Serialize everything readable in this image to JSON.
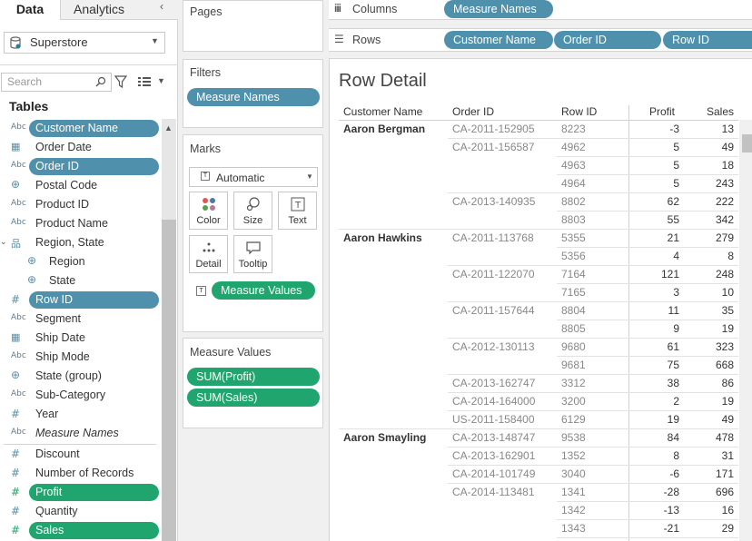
{
  "left_pane": {
    "tab_data": "Data",
    "tab_analytics": "Analytics",
    "collapse": "‹",
    "datasource": "Superstore",
    "search_placeholder": "Search",
    "tables_title": "Tables",
    "fields": [
      {
        "icon": "Abc",
        "label": "Customer Name",
        "style": "blue"
      },
      {
        "icon": "calendar-icon",
        "label": "Order Date",
        "style": ""
      },
      {
        "icon": "Abc",
        "label": "Order ID",
        "style": "blue"
      },
      {
        "icon": "globe-icon",
        "label": "Postal Code",
        "style": ""
      },
      {
        "icon": "Abc",
        "label": "Product ID",
        "style": ""
      },
      {
        "icon": "Abc",
        "label": "Product Name",
        "style": ""
      },
      {
        "icon": "hierarchy-icon",
        "label": "Region, State",
        "style": "hier"
      },
      {
        "icon": "globe-icon",
        "label": "Region",
        "style": "indent"
      },
      {
        "icon": "globe-icon",
        "label": "State",
        "style": "indent"
      },
      {
        "icon": "#",
        "label": "Row ID",
        "style": "blue"
      },
      {
        "icon": "Abc",
        "label": "Segment",
        "style": ""
      },
      {
        "icon": "calendar-icon",
        "label": "Ship Date",
        "style": ""
      },
      {
        "icon": "Abc",
        "label": "Ship Mode",
        "style": ""
      },
      {
        "icon": "globe-icon",
        "label": "State (group)",
        "style": ""
      },
      {
        "icon": "Abc",
        "label": "Sub-Category",
        "style": ""
      },
      {
        "icon": "#",
        "label": "Year",
        "style": ""
      },
      {
        "icon": "Abc",
        "label": "Measure Names",
        "style": "italic"
      },
      {
        "icon": "#",
        "label": "Discount",
        "style": ""
      },
      {
        "icon": "#",
        "label": "Number of Records",
        "style": ""
      },
      {
        "icon": "#",
        "label": "Profit",
        "style": "green"
      },
      {
        "icon": "#",
        "label": "Quantity",
        "style": ""
      },
      {
        "icon": "#",
        "label": "Sales",
        "style": "green"
      }
    ]
  },
  "shelves": {
    "pages": "Pages",
    "filters": "Filters",
    "filter_pill": "Measure Names",
    "marks": "Marks",
    "mark_type": "Automatic",
    "mark_buttons": [
      "Color",
      "Size",
      "Text",
      "Detail",
      "Tooltip"
    ],
    "marks_pill": "Measure Values",
    "measure_values_title": "Measure Values",
    "measure_values_pills": [
      "SUM(Profit)",
      "SUM(Sales)"
    ],
    "columns_label": "Columns",
    "columns_pill": "Measure Names",
    "rows_label": "Rows",
    "rows_pills": [
      "Customer Name",
      "Order ID",
      "Row ID"
    ]
  },
  "view": {
    "title": "Row Detail",
    "headers": [
      "Customer Name",
      "Order ID",
      "Row ID",
      "Profit",
      "Sales"
    ],
    "rows": [
      {
        "customer": "Aaron Bergman",
        "order": "CA-2011-152905",
        "row_id": "8223",
        "profit": "-3",
        "sales": "13"
      },
      {
        "customer": "",
        "order": "CA-2011-156587",
        "row_id": "4962",
        "profit": "5",
        "sales": "49"
      },
      {
        "customer": "",
        "order": "",
        "row_id": "4963",
        "profit": "5",
        "sales": "18"
      },
      {
        "customer": "",
        "order": "",
        "row_id": "4964",
        "profit": "5",
        "sales": "243"
      },
      {
        "customer": "",
        "order": "CA-2013-140935",
        "row_id": "8802",
        "profit": "62",
        "sales": "222"
      },
      {
        "customer": "",
        "order": "",
        "row_id": "8803",
        "profit": "55",
        "sales": "342"
      },
      {
        "customer": "Aaron Hawkins",
        "order": "CA-2011-113768",
        "row_id": "5355",
        "profit": "21",
        "sales": "279"
      },
      {
        "customer": "",
        "order": "",
        "row_id": "5356",
        "profit": "4",
        "sales": "8"
      },
      {
        "customer": "",
        "order": "CA-2011-122070",
        "row_id": "7164",
        "profit": "121",
        "sales": "248"
      },
      {
        "customer": "",
        "order": "",
        "row_id": "7165",
        "profit": "3",
        "sales": "10"
      },
      {
        "customer": "",
        "order": "CA-2011-157644",
        "row_id": "8804",
        "profit": "11",
        "sales": "35"
      },
      {
        "customer": "",
        "order": "",
        "row_id": "8805",
        "profit": "9",
        "sales": "19"
      },
      {
        "customer": "",
        "order": "CA-2012-130113",
        "row_id": "9680",
        "profit": "61",
        "sales": "323"
      },
      {
        "customer": "",
        "order": "",
        "row_id": "9681",
        "profit": "75",
        "sales": "668"
      },
      {
        "customer": "",
        "order": "CA-2013-162747",
        "row_id": "3312",
        "profit": "38",
        "sales": "86"
      },
      {
        "customer": "",
        "order": "CA-2014-164000",
        "row_id": "3200",
        "profit": "2",
        "sales": "19"
      },
      {
        "customer": "",
        "order": "US-2011-158400",
        "row_id": "6129",
        "profit": "19",
        "sales": "49"
      },
      {
        "customer": "Aaron Smayling",
        "order": "CA-2013-148747",
        "row_id": "9538",
        "profit": "84",
        "sales": "478"
      },
      {
        "customer": "",
        "order": "CA-2013-162901",
        "row_id": "1352",
        "profit": "8",
        "sales": "31"
      },
      {
        "customer": "",
        "order": "CA-2014-101749",
        "row_id": "3040",
        "profit": "-6",
        "sales": "171"
      },
      {
        "customer": "",
        "order": "CA-2014-113481",
        "row_id": "1341",
        "profit": "-28",
        "sales": "696"
      },
      {
        "customer": "",
        "order": "",
        "row_id": "1342",
        "profit": "-13",
        "sales": "16"
      },
      {
        "customer": "",
        "order": "",
        "row_id": "1343",
        "profit": "-21",
        "sales": "29"
      }
    ]
  },
  "colors": {
    "dimension_pill": "#4f90ac",
    "measure_pill": "#1fa56d"
  }
}
